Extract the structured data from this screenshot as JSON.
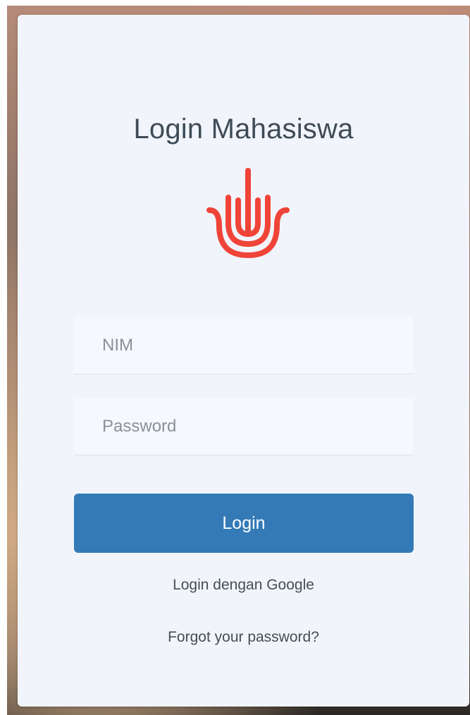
{
  "form": {
    "title": "Login Mahasiswa",
    "logo_icon": "hand-logo-icon",
    "nim_placeholder": "NIM",
    "nim_value": "",
    "password_placeholder": "Password",
    "password_value": "",
    "login_label": "Login",
    "google_link": "Login dengan Google",
    "forgot_link": "Forgot your password?"
  },
  "colors": {
    "accent": "#337ab7",
    "logo": "#f04438",
    "card_bg": "#f1f5fb"
  }
}
